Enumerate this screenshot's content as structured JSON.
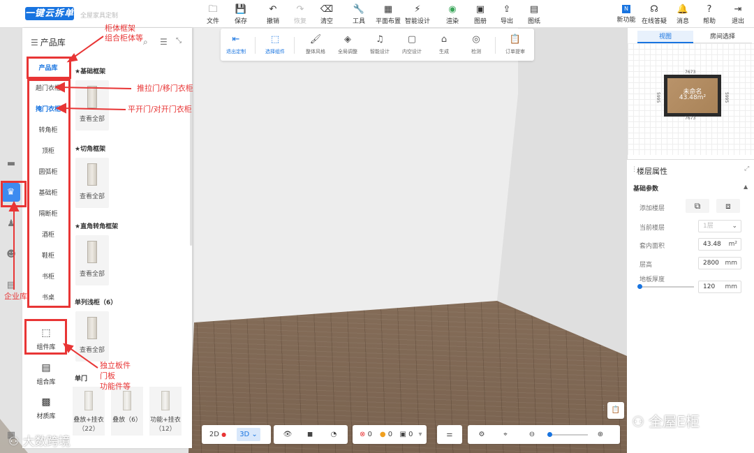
{
  "brand": {
    "logo": "一键云拆单",
    "subtitle": "全屋家具定制"
  },
  "toolbar": {
    "left": [
      {
        "label": "文件",
        "icon": "file-icon"
      },
      {
        "label": "保存",
        "icon": "save-icon"
      },
      {
        "label": "撤销",
        "icon": "undo-icon"
      },
      {
        "label": "恢复",
        "icon": "redo-icon",
        "disabled": true
      },
      {
        "label": "清空",
        "icon": "eraser-icon"
      },
      {
        "label": "工具",
        "icon": "wrench-icon"
      },
      {
        "label": "平面布置",
        "icon": "layout-icon"
      },
      {
        "label": "智能设计",
        "icon": "lightning-icon"
      },
      {
        "label": "渲染",
        "icon": "render-icon"
      },
      {
        "label": "图册",
        "icon": "album-icon"
      },
      {
        "label": "导出",
        "icon": "export-icon"
      },
      {
        "label": "图纸",
        "icon": "drawing-icon"
      }
    ],
    "right": [
      {
        "label": "新功能",
        "icon": "new-feature-icon"
      },
      {
        "label": "在线答疑",
        "icon": "headset-icon"
      },
      {
        "label": "消息",
        "icon": "bell-icon"
      },
      {
        "label": "帮助",
        "icon": "help-icon"
      },
      {
        "label": "退出",
        "icon": "exit-icon"
      }
    ]
  },
  "subtoolbar": [
    {
      "label": "退出定制",
      "icon": "exit-custom-icon"
    },
    {
      "label": "选择组件",
      "icon": "select-component-icon"
    },
    {
      "label": "整体风格",
      "icon": "style-icon"
    },
    {
      "label": "全局调整",
      "icon": "global-adjust-icon"
    },
    {
      "label": "智能设计",
      "icon": "smart-design-icon"
    },
    {
      "label": "内空设计",
      "icon": "inner-space-icon"
    },
    {
      "label": "生成",
      "icon": "generate-icon"
    },
    {
      "label": "检测",
      "icon": "inspect-icon"
    },
    {
      "label": "订单提审",
      "icon": "order-submit-icon"
    }
  ],
  "panel": {
    "title": "产品库",
    "categories": [
      "产品库",
      "趟门衣柜",
      "掩门衣柜",
      "转角柜",
      "顶柜",
      "圆弧柜",
      "基础柜",
      "隔断柜",
      "酒柜",
      "鞋柜",
      "书柜",
      "书桌"
    ],
    "sections": [
      {
        "title": "★基础框架",
        "card": "查看全部"
      },
      {
        "title": "★切角框架",
        "card": "查看全部"
      },
      {
        "title": "★直角转角框架",
        "card": "查看全部"
      },
      {
        "title": "单列浅柜（6）",
        "card": "查看全部"
      }
    ],
    "door_section": "单门",
    "door_items": [
      {
        "label": "叠放+挂衣",
        "count": "（22）"
      },
      {
        "label": "叠放（6）",
        "count": ""
      },
      {
        "label": "功能+挂衣",
        "count": "（12）"
      }
    ],
    "libraries": [
      "组件库",
      "组合库",
      "材质库"
    ]
  },
  "annotations": {
    "a1": "柜体框架",
    "a2": "组合柜体等",
    "a3": "推拉门/移门衣柜",
    "a4": "平开门/对开门衣柜",
    "a5": "独立板件",
    "a6": "门板",
    "a7": "功能件等",
    "a8": "企业库",
    "color": "#e83535"
  },
  "right_panel": {
    "tabs": [
      "视图",
      "房间选择"
    ],
    "room": {
      "name": "未命名",
      "area": "43.48m²",
      "dim_top": "7673",
      "dim_bottom": "7673",
      "dim_left": "5995",
      "dim_right": "5995"
    },
    "floor_props": {
      "title": "楼层属性",
      "section": "基础参数",
      "add_floor": "添加楼层",
      "current_floor": "当前楼层",
      "current_floor_value": "1层",
      "area_label": "套内面积",
      "area_value": "43.48",
      "area_unit": "m²",
      "height_label": "层高",
      "height_value": "2800",
      "height_unit": "mm",
      "thickness_label": "地板厚度",
      "thickness_value": "120",
      "thickness_unit": "mm"
    }
  },
  "bottom_bar": {
    "view_2d": "2D",
    "view_3d": "3D",
    "errors": "0",
    "warnings": "0",
    "infos": "0"
  },
  "watermarks": {
    "left": "大数跨境",
    "right": "全屋E柜"
  },
  "colors": {
    "accent": "#1874e0",
    "annotation": "#e83535"
  }
}
